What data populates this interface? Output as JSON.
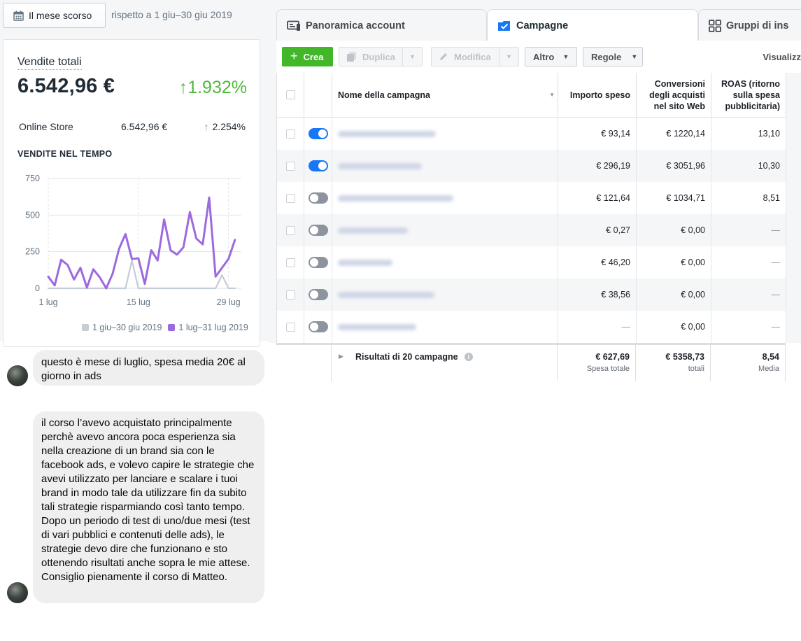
{
  "shopify": {
    "date_button_label": "Il mese scorso",
    "comparison_text": "rispetto a 1 giu–30 giu 2019",
    "total_sales_title": "Vendite totali",
    "total_sales_value": "6.542,96 €",
    "total_sales_change": "1.932%",
    "channel": {
      "name": "Online Store",
      "value": "6.542,96 €",
      "change": "2.254%"
    },
    "chart_heading": "VENDITE NEL TEMPO",
    "legend": {
      "previous": "1 giu–30 giu 2019",
      "current": "1 lug–31 lug 2019"
    },
    "colors": {
      "current": "#9c6ade",
      "previous": "#c4cdd5",
      "positive": "#50b83c"
    }
  },
  "chart_data": {
    "type": "line",
    "title": "VENDITE NEL TEMPO",
    "x_tick_labels": [
      "1 lug",
      "15 lug",
      "29 lug"
    ],
    "y_ticks": [
      0,
      250,
      500,
      750
    ],
    "ylim": [
      0,
      750
    ],
    "x": [
      1,
      2,
      3,
      4,
      5,
      6,
      7,
      8,
      9,
      10,
      11,
      12,
      13,
      14,
      15,
      16,
      17,
      18,
      19,
      20,
      21,
      22,
      23,
      24,
      25,
      26,
      27,
      28,
      29,
      30,
      31
    ],
    "series": [
      {
        "name": "1 lug–31 lug 2019",
        "color": "#9c6ade",
        "values": [
          80,
          20,
          195,
          160,
          60,
          140,
          5,
          130,
          75,
          0,
          100,
          270,
          370,
          200,
          205,
          30,
          260,
          190,
          470,
          260,
          230,
          280,
          520,
          340,
          300,
          620,
          80,
          140,
          200,
          330,
          null
        ]
      },
      {
        "name": "1 giu–30 giu 2019",
        "color": "#c4cdd5",
        "values": [
          0,
          0,
          0,
          0,
          0,
          0,
          0,
          0,
          0,
          0,
          0,
          0,
          0,
          190,
          0,
          0,
          0,
          0,
          0,
          0,
          0,
          0,
          0,
          0,
          0,
          0,
          0,
          90,
          0,
          0,
          null
        ]
      }
    ],
    "grid": true
  },
  "chat": [
    {
      "text": "questo è mese di luglio, spesa media 20€ al giorno in ads"
    },
    {
      "text": "il corso l’avevo acquistato principalmente perchè avevo ancora poca esperienza sia nella creazione di un brand sia con le facebook ads, e volevo capire le strategie che avevi utilizzato per lanciare e scalare i tuoi brand in modo tale da utilizzare fin da subito tali strategie risparmiando così tanto tempo. Dopo un periodo di test di uno/due mesi (test di vari pubblici e contenuti delle ads), le strategie devo dire che funzionano e sto ottenendo risultati anche sopra le mie attese. Consiglio pienamente il corso di Matteo."
    }
  ],
  "ads_manager": {
    "tabs": [
      {
        "label": "Panoramica account",
        "icon": "account-overview-icon"
      },
      {
        "label": "Campagne",
        "icon": "campaigns-icon"
      },
      {
        "label": "Gruppi di ins",
        "icon": "ad-sets-grid-icon"
      }
    ],
    "toolbar": {
      "create": "Crea",
      "duplicate": "Duplica",
      "edit": "Modifica",
      "more": "Altro",
      "rules": "Regole",
      "view": "Visualizz"
    },
    "columns": {
      "name": "Nome della campagna",
      "spend": "Importo speso",
      "conversions": "Conversioni degli acquisti nel sito Web",
      "roas": "ROAS (ritorno sulla spesa pubblicitaria)"
    },
    "rows": [
      {
        "active": true,
        "spend": "€ 93,14",
        "conversions": "€ 1220,14",
        "roas": "13,10"
      },
      {
        "active": true,
        "spend": "€ 296,19",
        "conversions": "€ 3051,96",
        "roas": "10,30"
      },
      {
        "active": false,
        "spend": "€ 121,64",
        "conversions": "€ 1034,71",
        "roas": "8,51"
      },
      {
        "active": false,
        "spend": "€ 0,27",
        "conversions": "€ 0,00",
        "roas": "—"
      },
      {
        "active": false,
        "spend": "€ 46,20",
        "conversions": "€ 0,00",
        "roas": "—"
      },
      {
        "active": false,
        "spend": "€ 38,56",
        "conversions": "€ 0,00",
        "roas": "—"
      },
      {
        "active": false,
        "spend": "—",
        "conversions": "€ 0,00",
        "roas": "—"
      }
    ],
    "totals": {
      "label": "Risultati di 20 campagne",
      "spend": "€ 627,69",
      "spend_sub": "Spesa totale",
      "conversions": "€ 5358,73",
      "conversions_sub": "totali",
      "roas": "8,54",
      "roas_sub": "Media"
    }
  }
}
